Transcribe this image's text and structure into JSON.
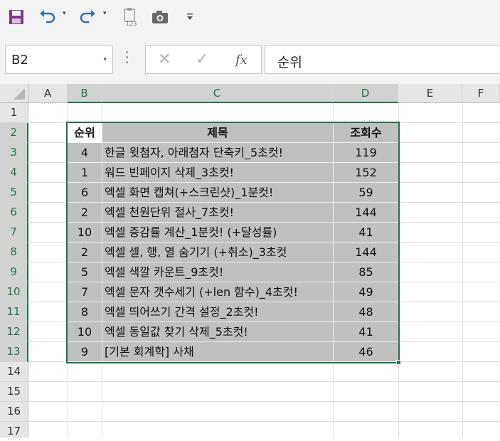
{
  "toolbar": {
    "icons": [
      "save-icon",
      "undo-icon",
      "redo-icon",
      "paste-values-icon",
      "camera-icon",
      "customize-icon"
    ],
    "paste_badge": "123"
  },
  "namebox": {
    "value": "B2"
  },
  "formula": {
    "fx_label": "fx",
    "value": "순위"
  },
  "columns": [
    "A",
    "B",
    "C",
    "D",
    "E",
    "F"
  ],
  "rows": [
    "1",
    "2",
    "3",
    "4",
    "5",
    "6",
    "7",
    "8",
    "9",
    "10",
    "11",
    "12",
    "13",
    "14",
    "15",
    "16",
    "17"
  ],
  "table": {
    "headers": {
      "rank": "순위",
      "title": "제목",
      "views": "조회수"
    },
    "rows": [
      {
        "rank": "4",
        "title": "한글 윗첨자, 아래첨자 단축키_5초컷!",
        "views": "119"
      },
      {
        "rank": "1",
        "title": "워드 빈페이지 삭제_3초컷!",
        "views": "152"
      },
      {
        "rank": "6",
        "title": "엑셀 화면 캡쳐(+스크린샷)_1분컷!",
        "views": "59"
      },
      {
        "rank": "2",
        "title": "엑셀 천원단위 절사_7초컷!",
        "views": "144"
      },
      {
        "rank": "10",
        "title": "엑셀 증감률 계산_1분컷! (+달성률)",
        "views": "41"
      },
      {
        "rank": "2",
        "title": "엑셀 셀, 행, 열 숨기기 (+취소)_3초컷",
        "views": "144"
      },
      {
        "rank": "5",
        "title": "엑셀 색깔 카운트_9초컷!",
        "views": "85"
      },
      {
        "rank": "7",
        "title": "엑셀 문자 갯수세기 (+len 함수)_4초컷!",
        "views": "49"
      },
      {
        "rank": "8",
        "title": "엑셀 띄어쓰기 간격 설정_2초컷!",
        "views": "48"
      },
      {
        "rank": "10",
        "title": "엑셀 동일값 찾기 삭제_5초컷!",
        "views": "41"
      },
      {
        "rank": "9",
        "title": "[기본 회계학] 사채",
        "views": "46"
      }
    ]
  }
}
